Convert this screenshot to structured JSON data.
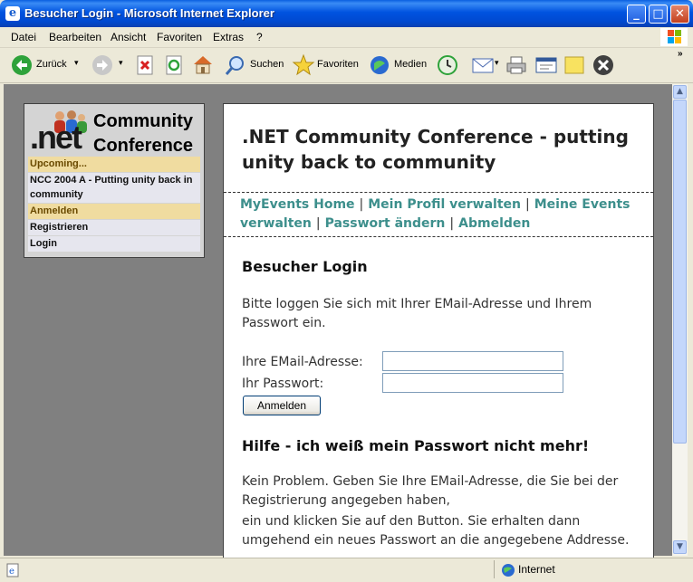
{
  "window": {
    "title": "Besucher Login - Microsoft Internet Explorer"
  },
  "menu": [
    "Datei",
    "Bearbeiten",
    "Ansicht",
    "Favoriten",
    "Extras",
    "?"
  ],
  "toolbar": {
    "back": "Zurück",
    "search": "Suchen",
    "favorites": "Favoriten",
    "media": "Medien"
  },
  "nav": {
    "logo_net": ".net",
    "logo_line1": "Community",
    "logo_line2": "Conference",
    "items": [
      {
        "label": "Upcoming...",
        "kind": "header"
      },
      {
        "label": "NCC 2004 A - Putting unity back in community",
        "kind": "item"
      },
      {
        "label": "Anmelden",
        "kind": "header"
      },
      {
        "label": "Registrieren",
        "kind": "item"
      },
      {
        "label": "Login",
        "kind": "item"
      }
    ]
  },
  "content": {
    "title": ".NET Community Conference - putting unity back to community",
    "links": [
      "MyEvents Home",
      "Mein Profil verwalten",
      "Meine Events verwalten",
      "Passwort ändern",
      "Abmelden"
    ],
    "login_heading": "Besucher Login",
    "login_intro": "Bitte loggen Sie sich mit Ihrer EMail-Adresse und Ihrem Passwort ein.",
    "email_label": "Ihre EMail-Adresse:",
    "email_value": "",
    "password_label": "Ihr Passwort:",
    "password_value": "",
    "login_button": "Anmelden",
    "help_heading": "Hilfe - ich weiß mein Passwort nicht mehr!",
    "help_line1": "Kein Problem. Geben Sie Ihre EMail-Adresse, die Sie bei der Registrierung angegeben haben,",
    "help_line2": "ein und klicken Sie auf den Button. Sie erhalten dann umgehend ein neues Passwort an die angegebene Addresse."
  },
  "status": {
    "zone": "Internet"
  },
  "colors": {
    "link": "#3d8f8c",
    "nav_header": "#f0dca0",
    "titlebar": "#0053e0"
  }
}
